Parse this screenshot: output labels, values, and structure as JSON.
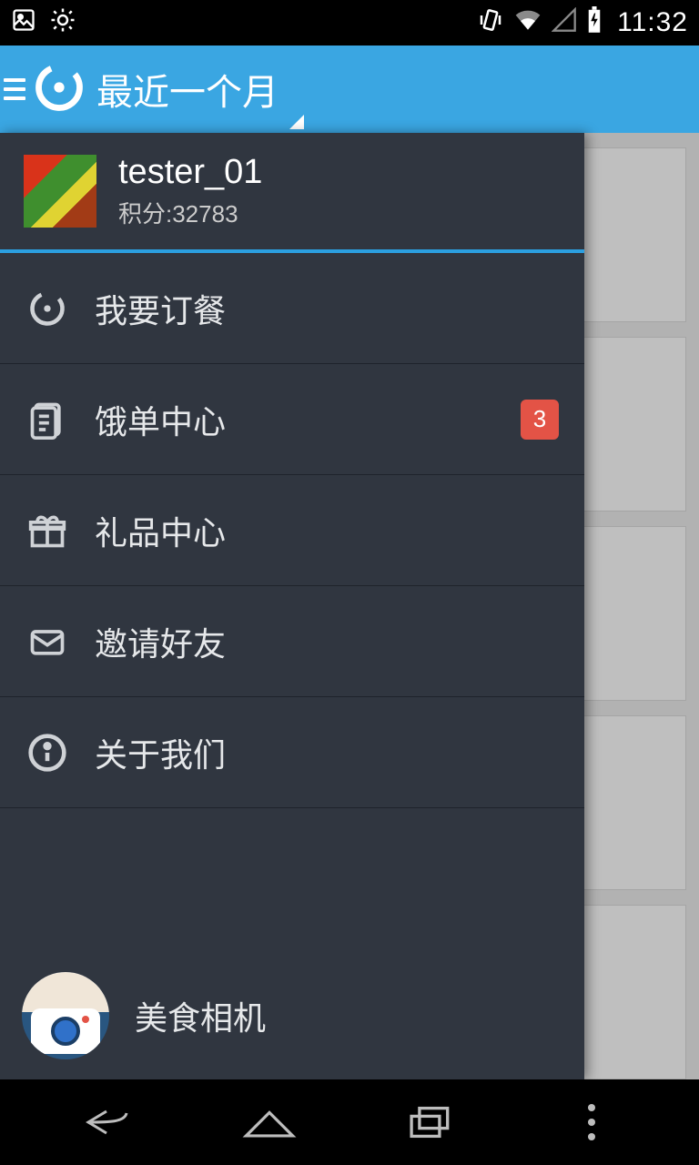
{
  "status": {
    "time": "11:32"
  },
  "header": {
    "title": "最近一个月"
  },
  "profile": {
    "username": "tester_01",
    "points_label": "积分:32783"
  },
  "menu": [
    {
      "label": "我要订餐",
      "icon": "order",
      "badge": null
    },
    {
      "label": "饿单中心",
      "icon": "clipboard",
      "badge": "3"
    },
    {
      "label": "礼品中心",
      "icon": "gift",
      "badge": null
    },
    {
      "label": "邀请好友",
      "icon": "mail",
      "badge": null
    },
    {
      "label": "关于我们",
      "icon": "info",
      "badge": null
    }
  ],
  "food_camera": {
    "label": "美食相机"
  }
}
